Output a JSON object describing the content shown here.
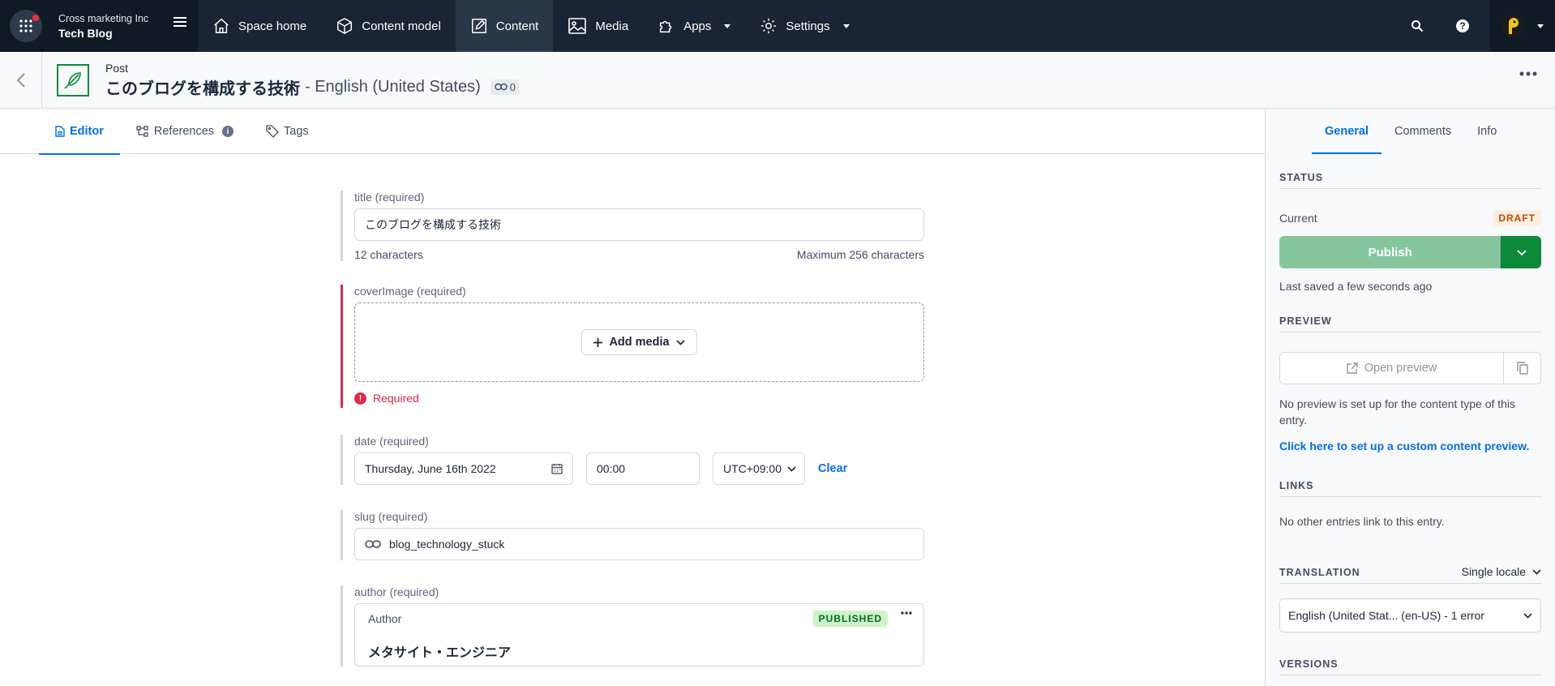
{
  "topnav": {
    "org_name": "Cross marketing Inc",
    "space_name": "Tech Blog",
    "items": [
      {
        "label": "Space home"
      },
      {
        "label": "Content model"
      },
      {
        "label": "Content"
      },
      {
        "label": "Media"
      },
      {
        "label": "Apps"
      },
      {
        "label": "Settings"
      }
    ]
  },
  "entry": {
    "type": "Post",
    "title": "このブログを構成する技術",
    "locale_suffix": "- English (United States)",
    "link_count": "0"
  },
  "tabs": [
    {
      "label": "Editor"
    },
    {
      "label": "References"
    },
    {
      "label": "Tags"
    }
  ],
  "fields": {
    "title": {
      "label": "title (required)",
      "value": "このブログを構成する技術",
      "count": "12 characters",
      "max": "Maximum 256 characters"
    },
    "cover": {
      "label": "coverImage (required)",
      "button": "Add media",
      "error": "Required"
    },
    "date": {
      "label": "date (required)",
      "date_value": "Thursday, June 16th 2022",
      "time_value": "00:00",
      "tz_value": "UTC+09:00",
      "clear": "Clear"
    },
    "slug": {
      "label": "slug (required)",
      "value": "blog_technology_stuck"
    },
    "author": {
      "label": "author (required)",
      "type": "Author",
      "status": "PUBLISHED",
      "name": "メタサイト・エンジニア"
    }
  },
  "sidebar": {
    "tabs": [
      {
        "label": "General"
      },
      {
        "label": "Comments"
      },
      {
        "label": "Info"
      }
    ],
    "status_heading": "STATUS",
    "current_label": "Current",
    "draft_badge": "DRAFT",
    "publish": "Publish",
    "saved": "Last saved a few seconds ago",
    "preview_heading": "PREVIEW",
    "open_preview": "Open preview",
    "preview_note": "No preview is set up for the content type of this entry.",
    "preview_link": "Click here to set up a custom content preview.",
    "links_heading": "LINKS",
    "links_note": "No other entries link to this entry.",
    "translation_heading": "TRANSLATION",
    "locale_mode": "Single locale",
    "translation_value": "English (United Stat... (en-US) - 1 error",
    "versions_heading": "VERSIONS"
  }
}
